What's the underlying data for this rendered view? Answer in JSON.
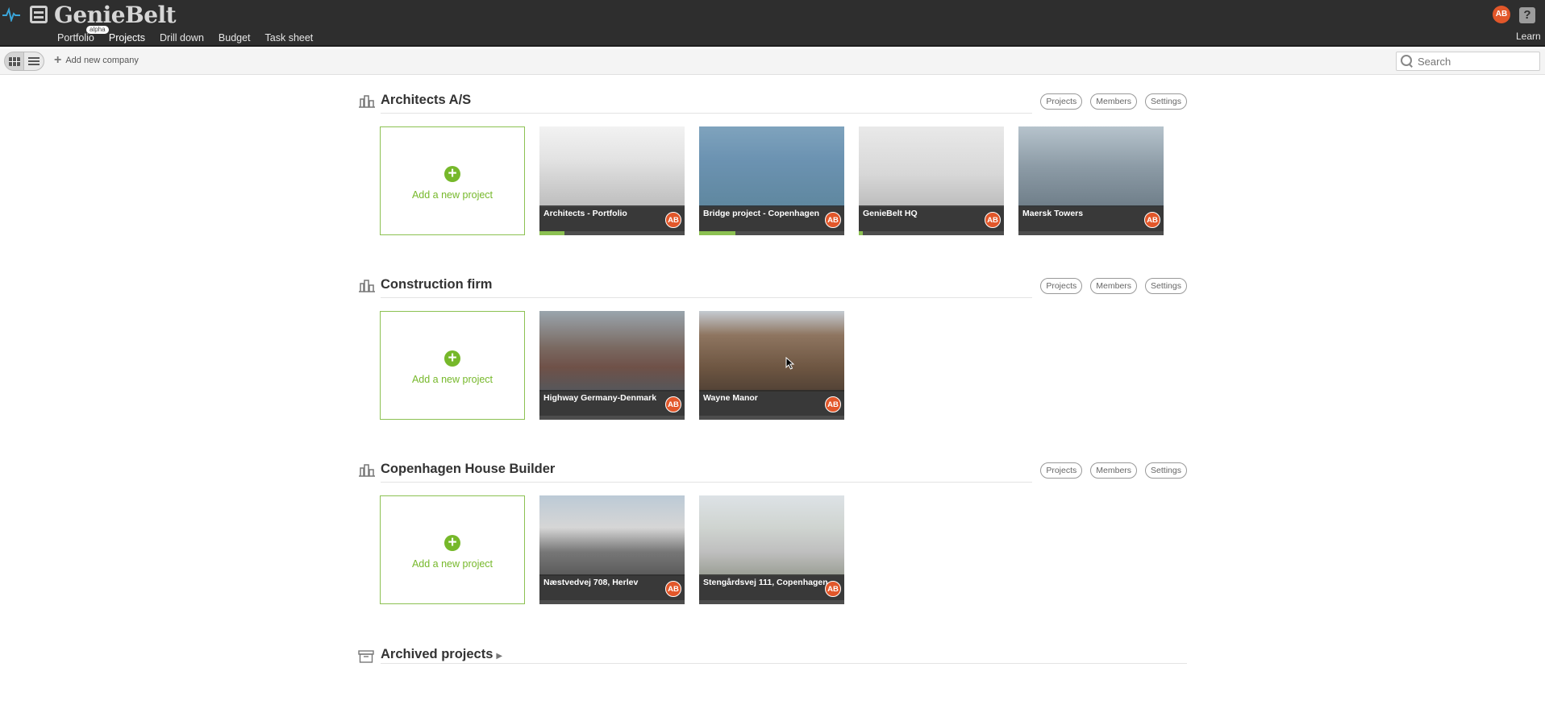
{
  "app": {
    "logo_text": "GenieBelt",
    "alpha_label": "alpha",
    "nav": [
      {
        "label": "Portfolio"
      },
      {
        "label": "Projects"
      },
      {
        "label": "Drill down"
      },
      {
        "label": "Budget"
      },
      {
        "label": "Task sheet"
      }
    ],
    "active_nav": "Projects",
    "user_initials": "AB",
    "help_label": "?",
    "learn_label": "Learn"
  },
  "toolbar": {
    "add_company_label": "Add new company",
    "search_placeholder": "Search"
  },
  "section_buttons": {
    "projects": "Projects",
    "members": "Members",
    "settings": "Settings"
  },
  "add_project_label": "Add a new project",
  "companies": [
    {
      "name": "Architects A/S",
      "projects": [
        {
          "name": "Architects - Portfolio",
          "owner": "AB",
          "progress": 0.17
        },
        {
          "name": "Bridge project - Copenhagen",
          "owner": "AB",
          "progress": 0.25
        },
        {
          "name": "GenieBelt HQ",
          "owner": "AB",
          "progress": 0.03
        },
        {
          "name": "Maersk Towers",
          "owner": "AB",
          "progress": 0
        }
      ]
    },
    {
      "name": "Construction firm",
      "projects": [
        {
          "name": "Highway Germany-Denmark",
          "owner": "AB",
          "progress": 0
        },
        {
          "name": "Wayne Manor",
          "owner": "AB",
          "progress": 0
        }
      ]
    },
    {
      "name": "Copenhagen House Builder",
      "projects": [
        {
          "name": "Næstvedvej 708, Herlev",
          "owner": "AB",
          "progress": 0
        },
        {
          "name": "Stengårdsvej 111, Copenhagen",
          "owner": "AB",
          "progress": 0
        }
      ]
    }
  ],
  "archived_label": "Archived projects",
  "colors": {
    "topbar": "#2e2e2e",
    "accent_green": "#76b82a",
    "avatar": "#e2572a"
  }
}
